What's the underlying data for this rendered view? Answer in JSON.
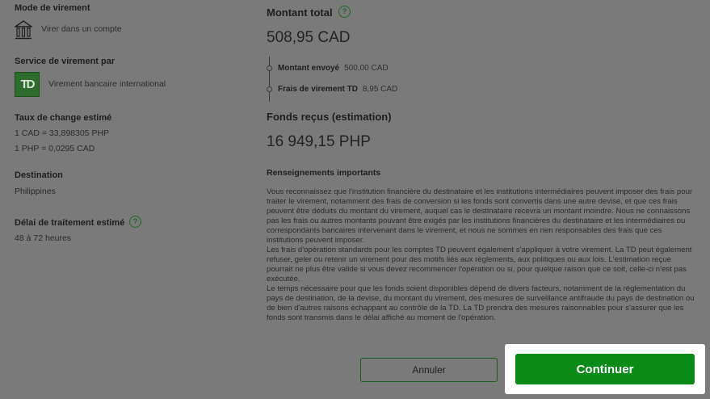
{
  "left": {
    "transfer_mode": {
      "label": "Mode de virement",
      "value": "Virer dans un compte",
      "icon": "bank-icon"
    },
    "service": {
      "label": "Service de virement par",
      "value": "Virement bancaire international",
      "logo_text": "TD"
    },
    "exchange": {
      "label": "Taux de change estimé",
      "rate1": "1 CAD = 33,898305 PHP",
      "rate2": "1 PHP = 0,0295 CAD"
    },
    "destination": {
      "label": "Destination",
      "value": "Philippines"
    },
    "processing": {
      "label": "Délai de traitement estimé",
      "value": "48 à 72 heures"
    }
  },
  "right": {
    "total": {
      "label": "Montant total",
      "amount": "508,95 CAD"
    },
    "sent": {
      "label": "Montant envoyé",
      "amount": "500,00 CAD"
    },
    "fee": {
      "label": "Frais de virement TD",
      "amount": "8,95 CAD"
    },
    "received": {
      "label": "Fonds reçus (estimation)",
      "amount": "16 949,15 PHP"
    },
    "notice_title": "Renseignements importants",
    "paragraphs": [
      "Vous reconnaissez que l'institution financière du destinataire et les institutions intermédiaires peuvent imposer des frais pour traiter le virement, notamment des frais de conversion si les fonds sont convertis dans une autre devise, et que ces frais peuvent être déduits du montant du virement, auquel cas le destinataire recevra un montant moindre. Nous ne connaissons pas les frais ou autres montants pouvant être exigés par les institutions financières du destinataire et les intermédiaires ou correspondants bancaires intervenant dans le virement, et nous ne sommes en rien responsables des frais que ces institutions peuvent imposer.",
      "Les frais d'opération standards pour les comptes TD peuvent également s'appliquer à votre virement. La TD peut également refuser, geler ou retenir un virement pour des motifs liés aux règlements, aux politiques ou aux lois. L'estimation reçue pourrait ne plus être valide si vous devez recommencer l'opération ou si, pour quelque raison que ce soit, celle-ci n'est pas exécutée.",
      "Le temps nécessaire pour que les fonds soient disponibles dépend de divers facteurs, notamment de la réglementation du pays de destination, de la devise, du montant du virement, des mesures de surveillance antifraude du pays de destination ou de bien d'autres raisons échappant au contrôle de la TD. La TD prendra des mesures raisonnables pour s'assurer que les fonds sont transmis dans le délai affiché au moment de l'opération."
    ],
    "help_glyph": "?"
  },
  "buttons": {
    "cancel": "Annuler",
    "continue": "Continuer"
  },
  "colors": {
    "overlay": "#7a7a7a",
    "brand_green": "#0a8a17",
    "td_green": "#2e6c2e"
  }
}
